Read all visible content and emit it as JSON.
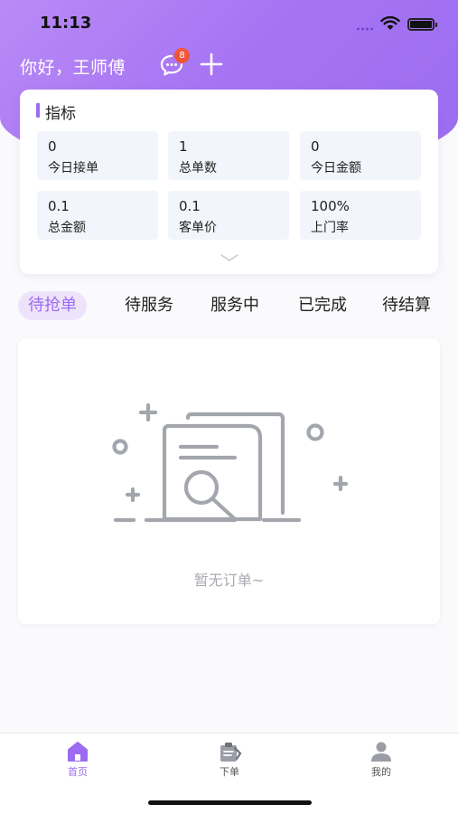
{
  "status_bar": {
    "time": "11:13"
  },
  "header": {
    "greeting": "你好，王师傅",
    "message_badge": "8"
  },
  "metrics": {
    "title": "指标",
    "items": [
      {
        "value": "0",
        "label": "今日接单"
      },
      {
        "value": "1",
        "label": "总单数"
      },
      {
        "value": "0",
        "label": "今日金额"
      },
      {
        "value": "0.1",
        "label": "总金额"
      },
      {
        "value": "0.1",
        "label": "客单价"
      },
      {
        "value": "100%",
        "label": "上门率"
      }
    ]
  },
  "order_tabs": [
    {
      "label": "待抢单",
      "active": true
    },
    {
      "label": "待服务",
      "active": false
    },
    {
      "label": "服务中",
      "active": false
    },
    {
      "label": "已完成",
      "active": false
    },
    {
      "label": "待结算",
      "active": false
    }
  ],
  "empty_state": {
    "text": "暂无订单~"
  },
  "tab_bar": [
    {
      "label": "首页",
      "icon": "home-icon",
      "active": true
    },
    {
      "label": "下单",
      "icon": "order-clipboard-icon",
      "active": false
    },
    {
      "label": "我的",
      "icon": "user-icon",
      "active": false
    }
  ],
  "colors": {
    "accent": "#9b6cf0",
    "badge": "#f0553a",
    "metric_bg": "#f2f5fb",
    "empty_text": "#a9abb3"
  }
}
